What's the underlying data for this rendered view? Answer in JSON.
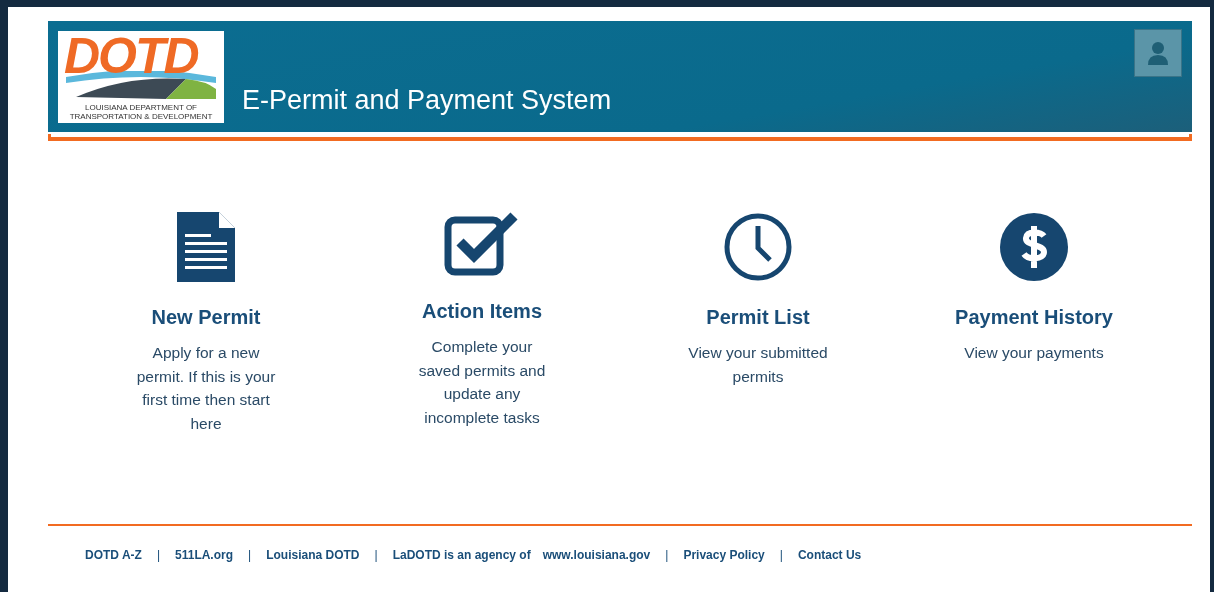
{
  "header": {
    "logo": {
      "wordmark": "DOTD",
      "line_1": "LOUISIANA DEPARTMENT OF",
      "line_2": "TRANSPORTATION & DEVELOPMENT"
    },
    "title": "E-Permit and Payment System"
  },
  "cards": [
    {
      "kind": "document",
      "title": "New Permit",
      "description": "Apply for a new permit. If this is your first time then start here"
    },
    {
      "kind": "checkbox",
      "title": "Action Items",
      "description": "Complete your saved permits and update any incomplete tasks"
    },
    {
      "kind": "clock",
      "title": "Permit List",
      "description": "View your submitted permits"
    },
    {
      "kind": "dollar",
      "title": "Payment History",
      "description": "View your payments"
    }
  ],
  "footer": [
    {
      "kind": "link",
      "text": "DOTD A-Z"
    },
    {
      "kind": "separator",
      "text": "|"
    },
    {
      "kind": "link",
      "text": "511LA.org"
    },
    {
      "kind": "separator",
      "text": "|"
    },
    {
      "kind": "link",
      "text": "Louisiana DOTD"
    },
    {
      "kind": "separator",
      "text": "|"
    },
    {
      "kind": "text",
      "text": "LaDOTD is an agency of"
    },
    {
      "kind": "link",
      "text": "www.louisiana.gov"
    },
    {
      "kind": "separator",
      "text": "|"
    },
    {
      "kind": "link",
      "text": "Privacy Policy"
    },
    {
      "kind": "separator",
      "text": "|"
    },
    {
      "kind": "link",
      "text": "Contact Us"
    }
  ]
}
